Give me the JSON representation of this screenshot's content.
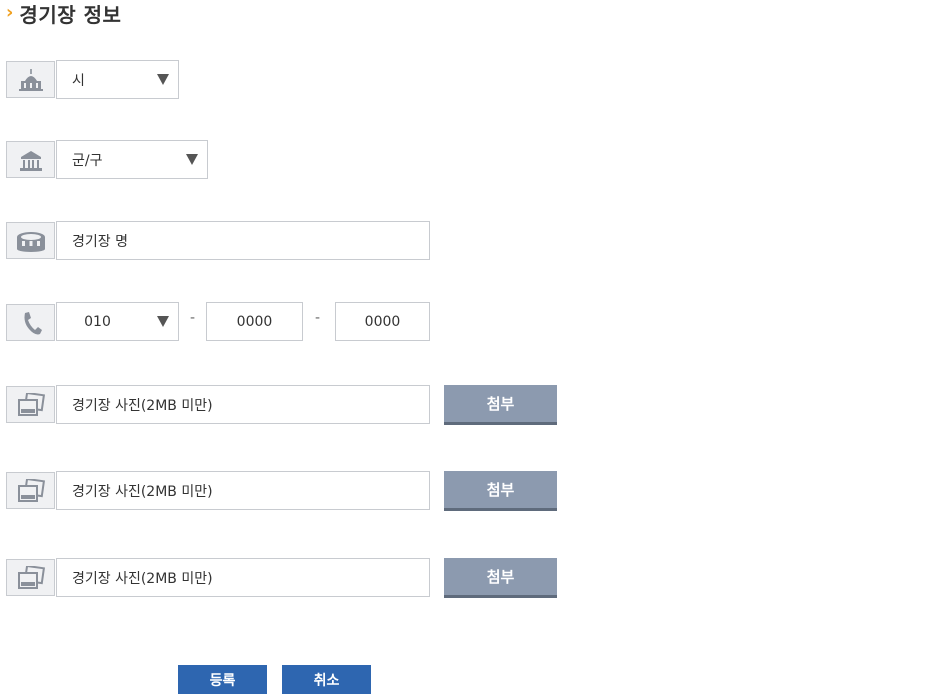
{
  "section": {
    "title": "경기장 정보"
  },
  "form": {
    "city": {
      "value": "시",
      "icon": "city-hall-icon"
    },
    "district": {
      "value": "군/구",
      "icon": "government-building-icon"
    },
    "stadium_name": {
      "placeholder": "경기장 명",
      "icon": "stadium-icon"
    },
    "phone": {
      "icon": "phone-icon",
      "prefix": "010",
      "separator": "-",
      "middle": "0000",
      "last": "0000"
    },
    "photos": [
      {
        "placeholder": "경기장 사진(2MB 미만)",
        "attach_label": "첨부",
        "icon": "photo-icon"
      },
      {
        "placeholder": "경기장 사진(2MB 미만)",
        "attach_label": "첨부",
        "icon": "photo-icon"
      },
      {
        "placeholder": "경기장 사진(2MB 미만)",
        "attach_label": "첨부",
        "icon": "photo-icon"
      }
    ]
  },
  "actions": {
    "register_label": "등록",
    "cancel_label": "취소"
  },
  "colors": {
    "accent": "#f0a020",
    "primary_button": "#2e66b0",
    "attach_button": "#8c9aaf"
  }
}
